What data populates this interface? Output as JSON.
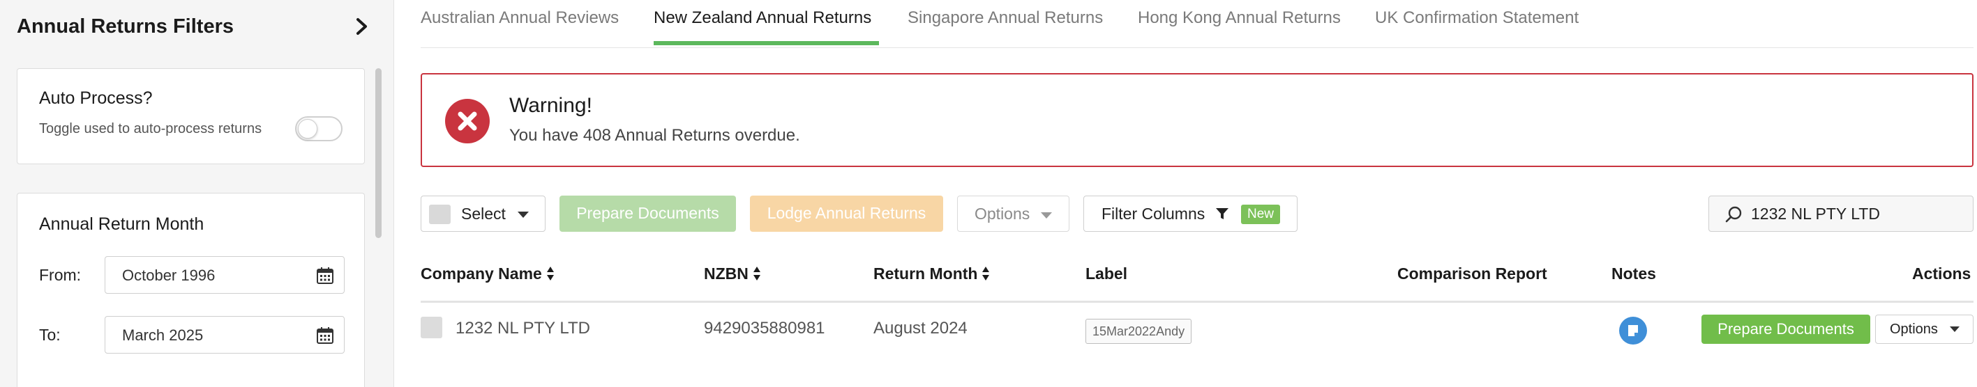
{
  "sidebar": {
    "title": "Annual Returns Filters",
    "auto_process": {
      "title": "Auto Process?",
      "description": "Toggle used to auto-process returns",
      "enabled": false
    },
    "annual_return_month": {
      "title": "Annual Return Month",
      "from_label": "From:",
      "from_value": "October 1996",
      "to_label": "To:",
      "to_value": "March 2025"
    }
  },
  "tabs": [
    {
      "label": "Australian Annual Reviews",
      "active": false
    },
    {
      "label": "New Zealand Annual Returns",
      "active": true
    },
    {
      "label": "Singapore Annual Returns",
      "active": false
    },
    {
      "label": "Hong Kong Annual Returns",
      "active": false
    },
    {
      "label": "UK Confirmation Statement",
      "active": false
    }
  ],
  "alert": {
    "title": "Warning!",
    "message": "You have 408 Annual Returns overdue."
  },
  "toolbar": {
    "select_label": "Select",
    "prepare_label": "Prepare Documents",
    "lodge_label": "Lodge Annual Returns",
    "options_label": "Options",
    "filter_label": "Filter Columns",
    "filter_badge": "New"
  },
  "search": {
    "value": "1232 NL PTY LTD"
  },
  "table": {
    "headers": {
      "company": "Company Name",
      "nzbn": "NZBN",
      "return_month": "Return Month",
      "label": "Label",
      "comparison": "Comparison Report",
      "notes": "Notes",
      "actions": "Actions"
    },
    "rows": [
      {
        "company": "1232 NL PTY LTD",
        "nzbn": "9429035880981",
        "return_month": "August 2024",
        "label": "15Mar2022Andy",
        "action_prepare": "Prepare Documents",
        "action_options": "Options"
      }
    ]
  },
  "colors": {
    "accent_green": "#5cb85c",
    "warning_red": "#c9343f",
    "notes_blue": "#3f8fd8"
  }
}
